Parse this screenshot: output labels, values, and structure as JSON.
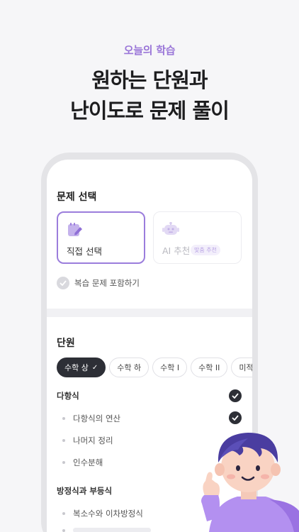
{
  "header": {
    "subtitle": "오늘의 학습",
    "headline_line1": "원하는 단원과",
    "headline_line2": "난이도로 문제 풀이"
  },
  "problem_select": {
    "title": "문제 선택",
    "cards": [
      {
        "label": "직접 선택",
        "icon": "notebook-pencil-icon",
        "selected": true
      },
      {
        "label": "AI 추천",
        "icon": "robot-icon",
        "badge": "맞춤 추천",
        "selected": false
      }
    ],
    "review_option": {
      "label": "복습 문제 포함하기",
      "checked": false
    }
  },
  "units": {
    "title": "단원",
    "chips": [
      {
        "label": "수학 상",
        "active": true
      },
      {
        "label": "수학 하",
        "active": false
      },
      {
        "label": "수학 I",
        "active": false
      },
      {
        "label": "수학 II",
        "active": false
      },
      {
        "label": "미적분",
        "active": false
      }
    ],
    "groups": [
      {
        "title": "다항식",
        "checked": true,
        "items": [
          {
            "label": "다항식의 연산",
            "checked": true
          },
          {
            "label": "나머지 정리",
            "checked": false
          },
          {
            "label": "인수분해",
            "checked": false
          }
        ]
      },
      {
        "title": "방정식과 부등식",
        "checked": false,
        "items": [
          {
            "label": "복소수와 이차방정식",
            "checked": false
          },
          {
            "label": "",
            "checked": false
          }
        ]
      }
    ]
  },
  "colors": {
    "accent": "#9b7ddc",
    "dark": "#2d2f36",
    "background": "#f6f6f8"
  }
}
